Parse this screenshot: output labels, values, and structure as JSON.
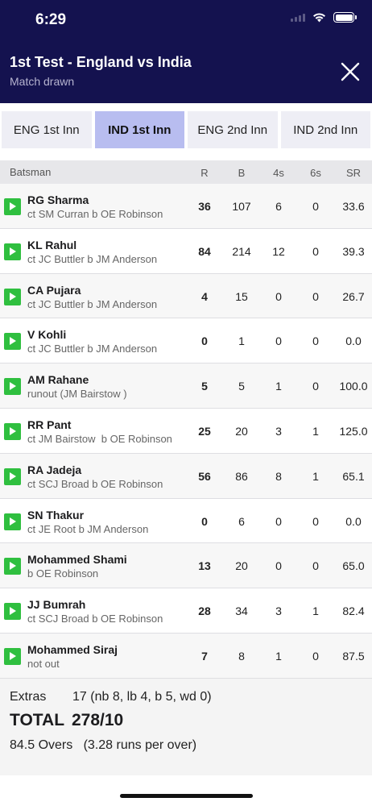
{
  "status_bar": {
    "time": "6:29"
  },
  "header": {
    "title": "1st Test - England vs India",
    "subtitle": "Match drawn"
  },
  "tabs": [
    {
      "label": "ENG 1st Inn",
      "active": false
    },
    {
      "label": "IND 1st Inn",
      "active": true
    },
    {
      "label": "ENG 2nd Inn",
      "active": false
    },
    {
      "label": "IND 2nd Inn",
      "active": false
    }
  ],
  "columns": {
    "batsman": "Batsman",
    "r": "R",
    "b": "B",
    "fours": "4s",
    "sixes": "6s",
    "sr": "SR"
  },
  "batsmen": [
    {
      "name": "RG Sharma",
      "dismissal": "ct SM Curran b OE Robinson",
      "r": "36",
      "b": "107",
      "fours": "6",
      "sixes": "0",
      "sr": "33.6"
    },
    {
      "name": "KL Rahul",
      "dismissal": "ct JC Buttler b JM Anderson",
      "r": "84",
      "b": "214",
      "fours": "12",
      "sixes": "0",
      "sr": "39.3"
    },
    {
      "name": "CA Pujara",
      "dismissal": "ct JC Buttler b JM Anderson",
      "r": "4",
      "b": "15",
      "fours": "0",
      "sixes": "0",
      "sr": "26.7"
    },
    {
      "name": "V Kohli",
      "dismissal": "ct JC Buttler b JM Anderson",
      "r": "0",
      "b": "1",
      "fours": "0",
      "sixes": "0",
      "sr": "0.0"
    },
    {
      "name": "AM Rahane",
      "dismissal": "runout (JM Bairstow )",
      "r": "5",
      "b": "5",
      "fours": "1",
      "sixes": "0",
      "sr": "100.0"
    },
    {
      "name": "RR Pant",
      "dismissal": "ct JM Bairstow  b OE Robinson",
      "r": "25",
      "b": "20",
      "fours": "3",
      "sixes": "1",
      "sr": "125.0"
    },
    {
      "name": "RA Jadeja",
      "dismissal": "ct SCJ Broad b OE Robinson",
      "r": "56",
      "b": "86",
      "fours": "8",
      "sixes": "1",
      "sr": "65.1"
    },
    {
      "name": "SN Thakur",
      "dismissal": "ct JE Root b JM Anderson",
      "r": "0",
      "b": "6",
      "fours": "0",
      "sixes": "0",
      "sr": "0.0"
    },
    {
      "name": "Mohammed Shami",
      "dismissal": "b OE Robinson",
      "r": "13",
      "b": "20",
      "fours": "0",
      "sixes": "0",
      "sr": "65.0"
    },
    {
      "name": "JJ Bumrah",
      "dismissal": "ct SCJ Broad b OE Robinson",
      "r": "28",
      "b": "34",
      "fours": "3",
      "sixes": "1",
      "sr": "82.4"
    },
    {
      "name": "Mohammed Siraj",
      "dismissal": "not out",
      "r": "7",
      "b": "8",
      "fours": "1",
      "sixes": "0",
      "sr": "87.5"
    }
  ],
  "summary": {
    "extras_label": "Extras",
    "extras_value": "17 (nb 8, lb 4, b 5, wd 0)",
    "total_label": "TOTAL",
    "total_value": "278/10",
    "overs": "84.5 Overs   (3.28 runs per over)"
  },
  "colors": {
    "header_bg": "#14124f",
    "active_tab": "#b8bdf0",
    "play_button": "#2fbf3f"
  }
}
